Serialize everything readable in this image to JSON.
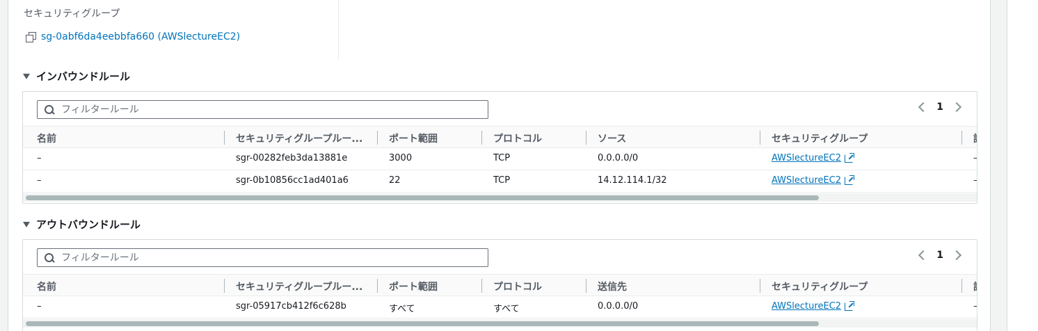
{
  "sg_label": "セキュリティグループ",
  "sg_link": "sg-0abf6da4eebbfa660 (AWSlectureEC2)",
  "inbound": {
    "title": "インバウンドルール",
    "filter_placeholder": "フィルタールール",
    "page": "1",
    "headers": [
      "名前",
      "セキュリティグループルー...",
      "ポート範囲",
      "プロトコル",
      "ソース",
      "セキュリティグループ",
      "説"
    ],
    "rows": [
      {
        "name": "–",
        "rule_id": "sgr-00282feb3da13881e",
        "port": "3000",
        "protocol": "TCP",
        "source": "0.0.0.0/0",
        "sg": "AWSlectureEC2",
        "desc": "–"
      },
      {
        "name": "–",
        "rule_id": "sgr-0b10856cc1ad401a6",
        "port": "22",
        "protocol": "TCP",
        "source": "14.12.114.1/32",
        "sg": "AWSlectureEC2",
        "desc": "–"
      }
    ]
  },
  "outbound": {
    "title": "アウトバウンドルール",
    "filter_placeholder": "フィルタールール",
    "page": "1",
    "headers": [
      "名前",
      "セキュリティグループルー...",
      "ポート範囲",
      "プロトコル",
      "送信先",
      "セキュリティグループ",
      "説"
    ],
    "rows": [
      {
        "name": "–",
        "rule_id": "sgr-05917cb412f6c628b",
        "port": "すべて",
        "protocol": "すべて",
        "source": "0.0.0.0/0",
        "sg": "AWSlectureEC2",
        "desc": "–"
      }
    ]
  }
}
